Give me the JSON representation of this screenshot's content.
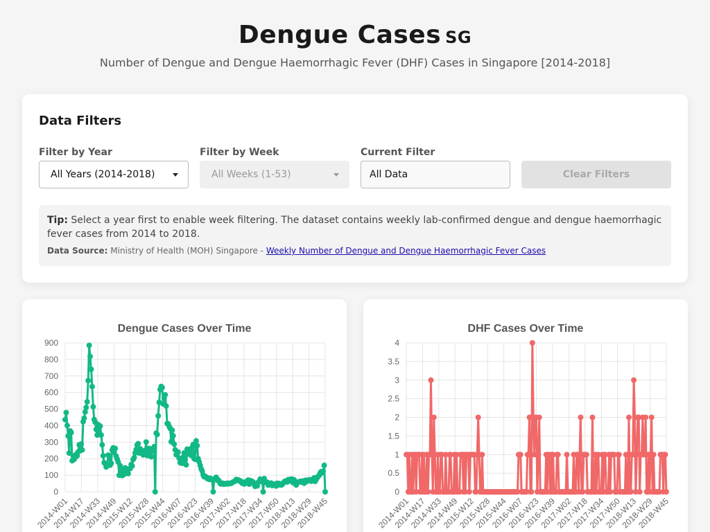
{
  "header": {
    "title": "Dengue Cases",
    "title_badge": "SG",
    "subtitle": "Number of Dengue and Dengue Haemorrhagic Fever (DHF) Cases in Singapore [2014-2018]"
  },
  "filters": {
    "heading": "Data Filters",
    "year": {
      "label": "Filter by Year",
      "value": "All Years (2014-2018)"
    },
    "week": {
      "label": "Filter by Week",
      "value": "All Weeks (1-53)"
    },
    "current": {
      "label": "Current Filter",
      "value": "All Data"
    },
    "clear_label": "Clear Filters",
    "tip_label": "Tip:",
    "tip_text": "Select a year first to enable week filtering. The dataset contains weekly lab-confirmed dengue and dengue haemorrhagic fever cases from 2014 to 2018.",
    "source_label": "Data Source:",
    "source_text": "Ministry of Health (MOH) Singapore -",
    "source_link": "Weekly Number of Dengue and Dengue Haemorrhagic Fever Cases"
  },
  "colors": {
    "dengue": "#12b886",
    "dhf": "#f06868"
  },
  "chart_data": [
    {
      "type": "line",
      "title": "Dengue Cases Over Time",
      "color": "#12b886",
      "ylim": [
        0,
        900
      ],
      "yticks": [
        0,
        100,
        200,
        300,
        400,
        500,
        600,
        700,
        800,
        900
      ],
      "xtick_labels": [
        "2014-W01",
        "2014-W17",
        "2014-W33",
        "2014-W49",
        "2015-W12",
        "2015-W28",
        "2015-W44",
        "2016-W07",
        "2016-W23",
        "2016-W39",
        "2017-W02",
        "2017-W18",
        "2017-W34",
        "2017-W50",
        "2018-W13",
        "2018-W29",
        "2018-W45"
      ],
      "grid": true,
      "values": [
        436,
        479,
        401,
        338,
        234,
        368,
        358,
        188,
        216,
        196,
        207,
        226,
        218,
        242,
        284,
        249,
        289,
        253,
        424,
        445,
        483,
        510,
        544,
        672,
        885,
        818,
        740,
        636,
        514,
        437,
        421,
        377,
        343,
        406,
        346,
        397,
        343,
        284,
        218,
        176,
        170,
        150,
        161,
        222,
        219,
        161,
        173,
        252,
        266,
        238,
        262,
        215,
        197,
        180,
        100,
        158,
        129,
        98,
        104,
        106,
        145,
        133,
        131,
        110,
        139,
        140,
        165,
        156,
        195,
        207,
        235,
        256,
        283,
        291,
        234,
        260,
        252,
        232,
        223,
        236,
        250,
        301,
        219,
        236,
        262,
        233,
        212,
        246,
        260,
        273,
        0,
        355,
        347,
        459,
        541,
        618,
        637,
        630,
        531,
        565,
        586,
        519,
        413,
        411,
        395,
        383,
        303,
        372,
        339,
        288,
        254,
        224,
        237,
        240,
        203,
        176,
        200,
        172,
        210,
        235,
        195,
        163,
        258,
        228,
        256,
        250,
        220,
        269,
        286,
        200,
        196,
        308,
        279,
        200,
        181,
        160,
        139,
        125,
        102,
        91,
        94,
        89,
        80,
        82,
        75,
        82,
        76,
        72,
        0,
        76,
        82,
        88,
        70,
        72,
        65,
        50,
        47,
        50,
        52,
        46,
        48,
        48,
        52,
        48,
        52,
        51,
        51,
        56,
        60,
        62,
        65,
        75,
        70,
        72,
        66,
        67,
        58,
        52,
        58,
        47,
        51,
        62,
        56,
        71,
        46,
        68,
        56,
        64,
        58,
        46,
        33,
        44,
        36,
        57,
        62,
        77,
        63,
        72,
        0,
        80,
        61,
        57,
        58,
        41,
        43,
        47,
        53,
        38,
        40,
        46,
        45,
        35,
        52,
        41,
        50,
        47,
        41,
        44,
        52,
        61,
        64,
        66,
        59,
        74,
        68,
        76,
        64,
        77,
        55,
        72,
        50,
        41,
        54,
        58,
        61,
        63,
        59,
        65,
        56,
        52,
        69,
        61,
        70,
        68,
        72,
        73,
        64,
        66,
        77,
        84,
        63,
        75,
        85,
        94,
        99,
        113,
        122,
        115,
        124,
        160,
        0
      ]
    },
    {
      "type": "line",
      "title": "DHF Cases Over Time",
      "color": "#f06868",
      "ylim": [
        0,
        4
      ],
      "yticks": [
        0,
        0.5,
        1,
        1.5,
        2,
        2.5,
        3,
        3.5,
        4
      ],
      "xtick_labels": [
        "2014-W01",
        "2014-W17",
        "2014-W33",
        "2014-W49",
        "2015-W12",
        "2015-W28",
        "2015-W44",
        "2016-W07",
        "2016-W23",
        "2016-W39",
        "2017-W02",
        "2017-W18",
        "2017-W34",
        "2017-W50",
        "2018-W13",
        "2018-W29",
        "2018-W45"
      ],
      "grid": true,
      "values": [
        1,
        1,
        0,
        1,
        0,
        0,
        1,
        0,
        1,
        1,
        0,
        1,
        1,
        1,
        0,
        0,
        1,
        0,
        1,
        0,
        0,
        1,
        0,
        1,
        1,
        3,
        1,
        0,
        2,
        1,
        0,
        0,
        1,
        0,
        0,
        1,
        1,
        0,
        0,
        0,
        1,
        0,
        0,
        0,
        1,
        1,
        0,
        0,
        0,
        1,
        0,
        1,
        0,
        0,
        0,
        1,
        1,
        1,
        0,
        1,
        0,
        1,
        1,
        1,
        0,
        1,
        1,
        1,
        1,
        1,
        0,
        0,
        1,
        2,
        1,
        0,
        0,
        1,
        0,
        0,
        0,
        0,
        0,
        0,
        0,
        0,
        0,
        0,
        0,
        0,
        0,
        0,
        0,
        0,
        0,
        0,
        0,
        0,
        0,
        0,
        0,
        0,
        0,
        0,
        0,
        0,
        0,
        0,
        0,
        0,
        0,
        0,
        0,
        0,
        1,
        1,
        1,
        0,
        0,
        0,
        0,
        0,
        0,
        1,
        1,
        2,
        0,
        0,
        4,
        2,
        1,
        2,
        2,
        0,
        1,
        2,
        0,
        0,
        0,
        0,
        0,
        0,
        1,
        0,
        1,
        1,
        0,
        1,
        0,
        1,
        0,
        0,
        0,
        1,
        1,
        0,
        0,
        0,
        0,
        0,
        0,
        0,
        0,
        1,
        0,
        0,
        0,
        0,
        0,
        0,
        1,
        0,
        0,
        1,
        1,
        0,
        1,
        2,
        0,
        0,
        1,
        1,
        1,
        1,
        0,
        0,
        0,
        0,
        0,
        2,
        0,
        0,
        1,
        0,
        1,
        1,
        0,
        0,
        0,
        1,
        0,
        1,
        1,
        0,
        0,
        0,
        1,
        0,
        1,
        1,
        1,
        1,
        0,
        0,
        0,
        1,
        1,
        0,
        0,
        0,
        0,
        0,
        0,
        1,
        0,
        0,
        2,
        0,
        0,
        1,
        1,
        3,
        2,
        0,
        1,
        2,
        2,
        0,
        1,
        1,
        2,
        1,
        1,
        2,
        0,
        0,
        1,
        0,
        1,
        2,
        0,
        1,
        0,
        0,
        0,
        0,
        0,
        0,
        1,
        1,
        1,
        0,
        1,
        1,
        0
      ]
    }
  ]
}
